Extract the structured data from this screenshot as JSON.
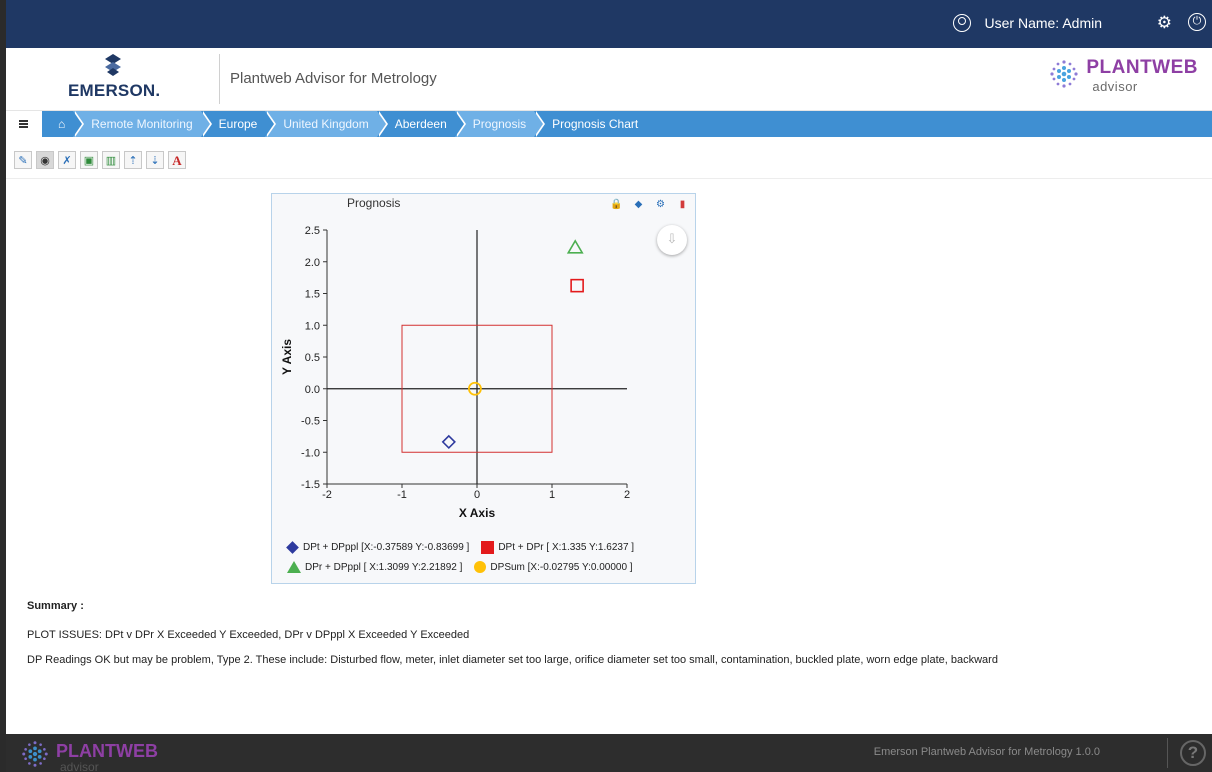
{
  "topbar": {
    "user_label": "User Name: Admin"
  },
  "header": {
    "company": "EMERSON.",
    "app_title": "Plantweb Advisor for Metrology",
    "brand": "PLANTWEB",
    "brand_sub": "advisor"
  },
  "breadcrumb": [
    "Remote Monitoring",
    "Europe",
    "United Kingdom",
    "Aberdeen",
    "Prognosis",
    "Prognosis Chart"
  ],
  "toolbar": {
    "text_tool_label": "A"
  },
  "panel": {
    "title": "Prognosis"
  },
  "chart_data": {
    "type": "scatter",
    "title": "Prognosis",
    "xlabel": "X Axis",
    "ylabel": "Y Axis",
    "xlim": [
      -2,
      2
    ],
    "ylim": [
      -1.5,
      2.5
    ],
    "xticks": [
      "-2",
      "-1",
      "0",
      "1",
      "2"
    ],
    "yticks": [
      "2.5",
      "2.0",
      "1.5",
      "1.0",
      "0.5",
      "0.0",
      "-0.5",
      "-1.0",
      "-1.5"
    ],
    "limit_box": {
      "x": [
        -1,
        1
      ],
      "y": [
        -1,
        1
      ]
    },
    "series": [
      {
        "name": "DPt + DPppl [X:-0.37589 Y:-0.83699 ]",
        "x": -0.37589,
        "y": -0.83699,
        "marker": "diamond",
        "color": "#2e3a9e"
      },
      {
        "name": "DPt + DPr [  X:1.335 Y:1.6237          ]",
        "x": 1.335,
        "y": 1.6237,
        "marker": "square",
        "color": "#e31a1c"
      },
      {
        "name": "DPr + DPppl [  X:1.3099 Y:2.21892          ]",
        "x": 1.3099,
        "y": 2.21892,
        "marker": "triangle",
        "color": "#4caf50"
      },
      {
        "name": "DPSum [X:-0.02795 Y:0.00000   ]",
        "x": -0.02795,
        "y": 0.0,
        "marker": "circle",
        "color": "#ffc107"
      }
    ]
  },
  "summary": {
    "title": "Summary :",
    "line1": "PLOT ISSUES: DPt v DPr X Exceeded Y Exceeded, DPr v DPppl X Exceeded Y Exceeded",
    "line2": "DP Readings OK but may be problem, Type 2. These include: Disturbed flow, meter,  inlet diameter set too large, orifice diameter set too small, contamination, buckled plate, worn edge plate, backward"
  },
  "footer": {
    "brand": "PLANTWEB",
    "brand_sub": "advisor",
    "version_text": "Emerson Plantweb Advisor for Metrology 1.0.0",
    "help_label": "?"
  }
}
